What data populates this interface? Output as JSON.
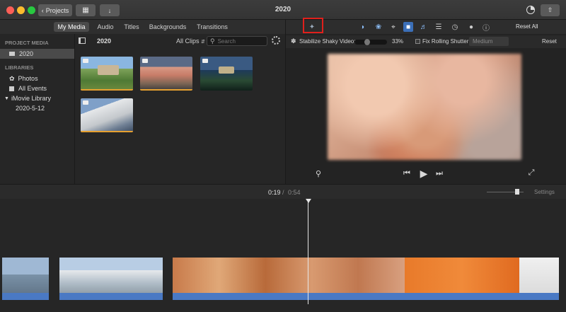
{
  "window": {
    "title": "2020",
    "projects_label": "Projects",
    "back_icon": "chevron-left-icon",
    "layout_icon": "layout-icon",
    "import_icon": "import-arrow-icon",
    "share_icon": "share-icon",
    "enhance_icon": "pie-icon"
  },
  "browser_tabs": [
    "My Media",
    "Audio",
    "Titles",
    "Backgrounds",
    "Transitions"
  ],
  "sidebar": {
    "project_media_heading": "PROJECT MEDIA",
    "project_item": "2020",
    "libraries_heading": "LIBRARIES",
    "library_items": [
      "Photos",
      "All Events"
    ],
    "imovie_library": "iMovie Library",
    "event_item": "2020-5-12"
  },
  "browser": {
    "event_title": "2020",
    "filter_label": "All Clips",
    "search_placeholder": "Search"
  },
  "viewer": {
    "adjustments": [
      "magic-wand-icon",
      "color-balance-icon",
      "color-correction-icon",
      "crop-icon",
      "stabilization-icon",
      "volume-icon",
      "noise-reduction-icon",
      "speed-icon",
      "clip-filter-icon",
      "info-icon"
    ],
    "reset_all_label": "Reset All",
    "stabilize_label": "Stabilize Shaky Video:",
    "stabilize_value": "33%",
    "stabilize_level": 0.33,
    "fix_rolling_label": "Fix Rolling Shutter:",
    "fix_rolling_value": "Medium",
    "reset_label": "Reset"
  },
  "timeline": {
    "current_time": "0:19",
    "separator": "/",
    "total_time": "0:54",
    "settings_label": "Settings"
  },
  "colors": {
    "accent_blue": "#3b8cf0",
    "highlight_red": "#e0201c",
    "audio_blue": "#4a79c4",
    "clip_bar": "#e6a030"
  }
}
